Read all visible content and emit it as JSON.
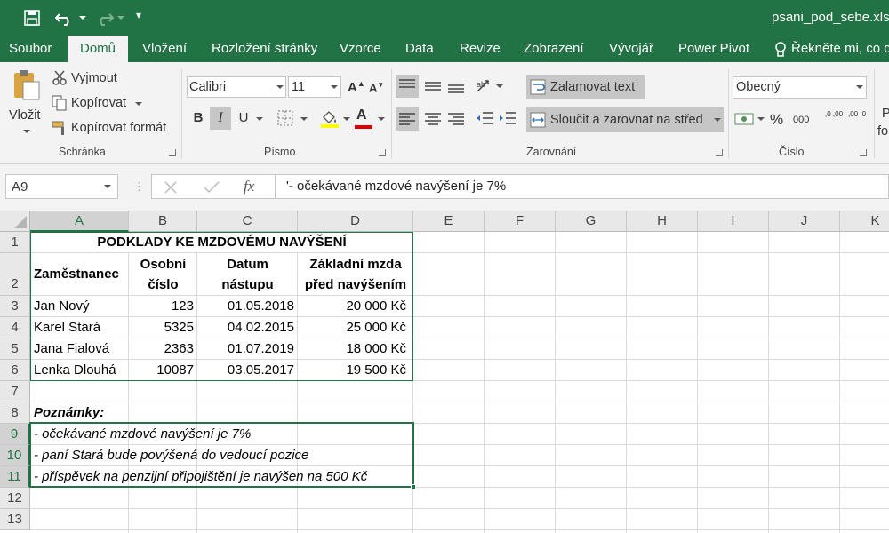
{
  "window": {
    "title": "psani_pod_sebe.xlsx"
  },
  "quick_access": {
    "customize_label": "▾"
  },
  "tabs": [
    {
      "label": "Soubor"
    },
    {
      "label": "Domů"
    },
    {
      "label": "Vložení"
    },
    {
      "label": "Rozložení stránky"
    },
    {
      "label": "Vzorce"
    },
    {
      "label": "Data"
    },
    {
      "label": "Revize"
    },
    {
      "label": "Zobrazení"
    },
    {
      "label": "Vývojář"
    },
    {
      "label": "Power Pivot"
    }
  ],
  "tell_me": "Řekněte mi, co c",
  "ribbon": {
    "clipboard": {
      "paste": "Vložit",
      "cut": "Vyjmout",
      "copy": "Kopírovat",
      "format_painter": "Kopírovat formát",
      "group": "Schránka"
    },
    "font": {
      "name": "Calibri",
      "size": "11",
      "group": "Písmo",
      "bold": "B",
      "italic": "I",
      "underline": "U"
    },
    "alignment": {
      "wrap": "Zalamovat text",
      "merge": "Sloučit a zarovnat na střed",
      "group": "Zarovnání"
    },
    "number": {
      "format": "Obecný",
      "group": "Číslo",
      "percent": "%",
      "thousands": "000",
      "inc_dec": ",0 ,00",
      "dec_dec": ",00 ,0"
    },
    "styles_cut": {
      "line1": "P",
      "line2": "fo"
    }
  },
  "formula_bar": {
    "name_box": "A9",
    "fx": "fx",
    "content": "'- očekávané mzdové navýšení je 7%"
  },
  "columns": [
    "A",
    "B",
    "C",
    "D",
    "E",
    "F",
    "G",
    "H",
    "I",
    "J",
    "K"
  ],
  "rows": [
    "1",
    "2",
    "3",
    "4",
    "5",
    "6",
    "7",
    "8",
    "9",
    "10",
    "11",
    "12",
    "13"
  ],
  "sheet": {
    "title": "PODKLADY KE MZDOVÉMU NAVÝŠENÍ",
    "headers": {
      "employee": "Zaměstnanec",
      "personal_no_1": "Osobní",
      "personal_no_2": "číslo",
      "date_1": "Datum",
      "date_2": "nástupu",
      "salary_1": "Základní mzda",
      "salary_2": "před navýšením"
    },
    "data": [
      {
        "name": "Jan Nový",
        "id": "123",
        "date": "01.05.2018",
        "salary": "20 000 Kč"
      },
      {
        "name": "Karel Stará",
        "id": "5325",
        "date": "04.02.2015",
        "salary": "25 000 Kč"
      },
      {
        "name": "Jana Fialová",
        "id": "2363",
        "date": "01.07.2019",
        "salary": "18 000 Kč"
      },
      {
        "name": "Lenka Dlouhá",
        "id": "10087",
        "date": "03.05.2017",
        "salary": "19 500 Kč"
      }
    ],
    "notes_title": "Poznámky:",
    "notes": [
      "- očekávané mzdové navýšení je 7%",
      "- paní Stará bude povýšená do vedoucí pozice",
      "- příspěvek na penzijní připojištění je navýšen na 500 Kč"
    ]
  },
  "colors": {
    "excel_green": "#217346",
    "ribbon_bg": "#f3f3f3",
    "selection": "#217346"
  }
}
